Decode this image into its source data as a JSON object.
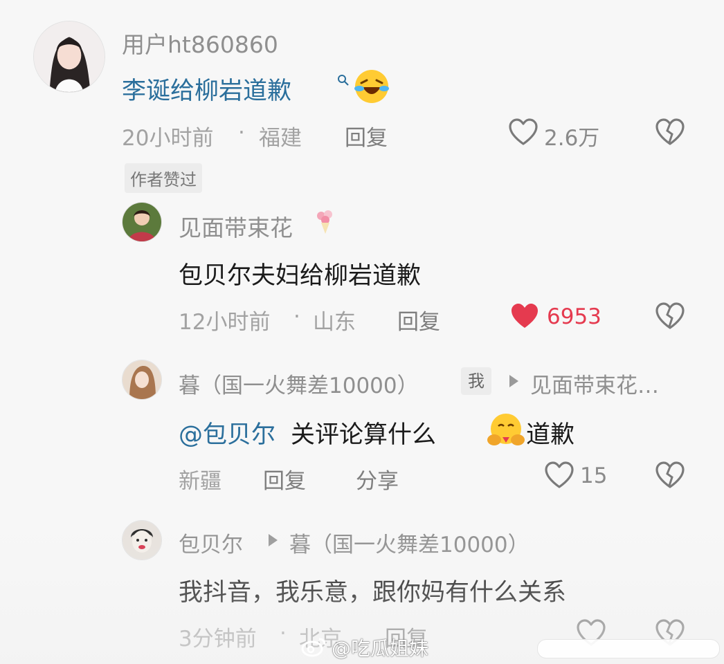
{
  "comments": [
    {
      "username": "用户ht860860",
      "text_link": "李诞给柳岩道歉",
      "time": "20小时前",
      "location": "福建",
      "reply_label": "回复",
      "likes": "2.6万",
      "tag": "作者赞过"
    },
    {
      "username": "见面带束花",
      "text": "包贝尔夫妇给柳岩道歉",
      "time": "12小时前",
      "location": "山东",
      "reply_label": "回复",
      "likes": "6953",
      "liked": true
    },
    {
      "username": "暮（国一火舞差10000）",
      "me_tag": "我",
      "reply_to": "见面带束花…",
      "mention": "@包贝尔",
      "text_a": " 关评论算什么",
      "text_b": "道歉",
      "location": "新疆",
      "reply_label": "回复",
      "share_label": "分享",
      "likes": "15"
    },
    {
      "username": "包贝尔",
      "reply_to": "暮（国一火舞差10000）",
      "text": "我抖音，我乐意，跟你妈有什么关系",
      "time": "3分钟前",
      "location": "北京",
      "reply_label": "回复"
    }
  ],
  "separator": "·",
  "watermark": "@吃瓜姐妹",
  "icons": {
    "like": "heart-outline-icon",
    "liked": "heart-filled-icon",
    "dislike": "broken-heart-icon",
    "search": "search-icon",
    "weibo": "weibo-logo-icon"
  },
  "colors": {
    "link": "#2b6f9c",
    "liked": "#e53a4f",
    "muted": "#a2a2a2"
  }
}
